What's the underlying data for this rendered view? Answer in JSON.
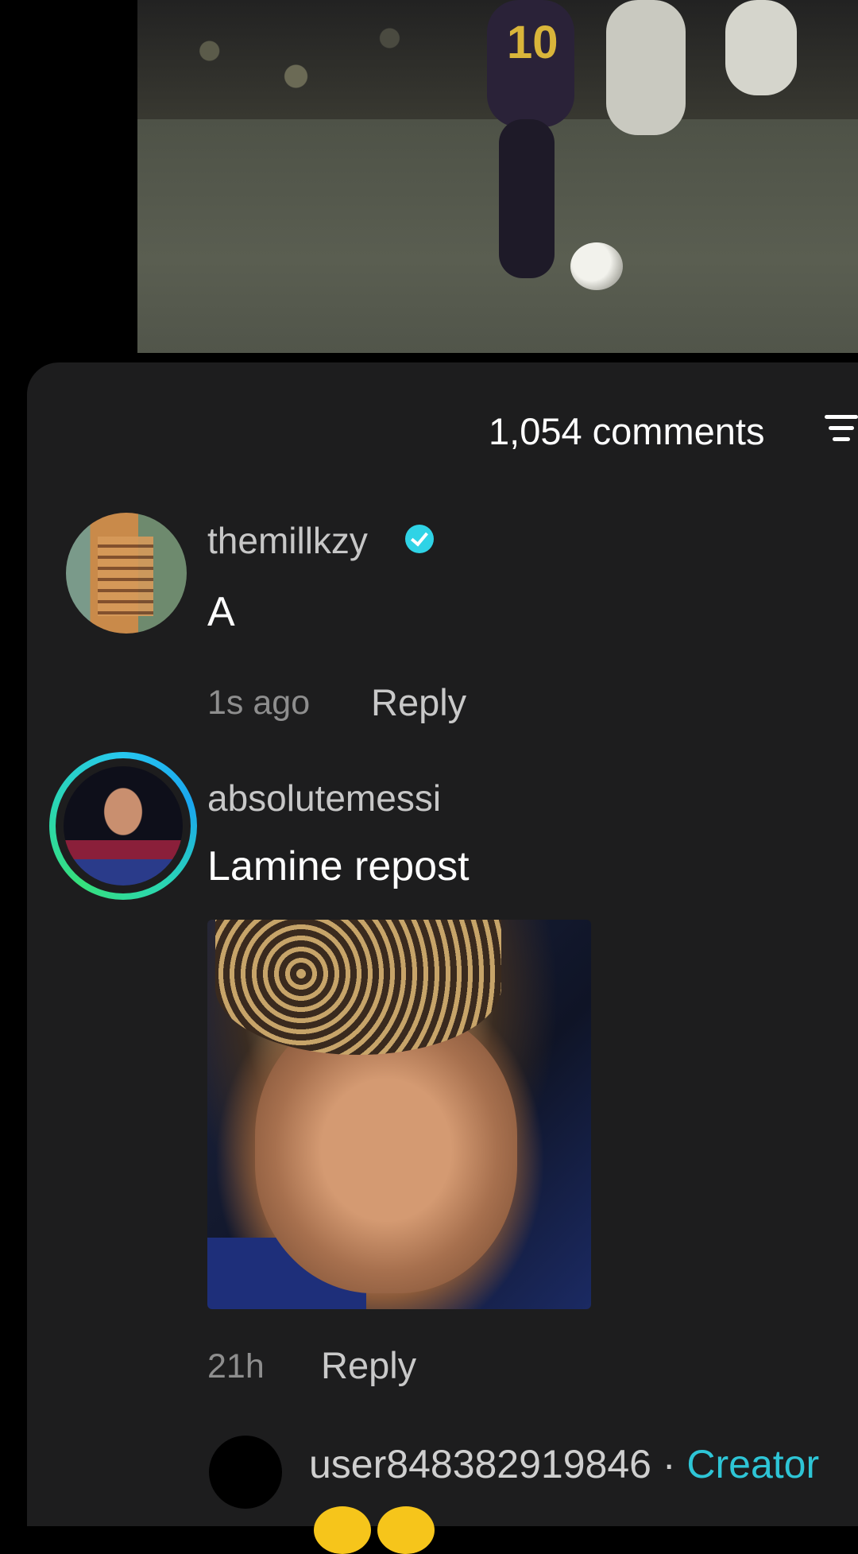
{
  "comments_header": {
    "count_label": "1,054 comments"
  },
  "comments": [
    {
      "username": "themillkzy",
      "verified": true,
      "text": "A",
      "time": "1s ago",
      "reply_label": "Reply"
    },
    {
      "username": "absolutemessi",
      "verified": false,
      "text": "Lamine repost",
      "time": "21h",
      "reply_label": "Reply"
    }
  ],
  "reply_preview": {
    "username": "user848382919846",
    "separator": " · ",
    "badge": "Creator"
  },
  "colors": {
    "sheet_bg": "#1d1d1e",
    "accent_cyan": "#2ec5d6",
    "ring_gradient_start": "#27c7f0",
    "ring_gradient_end": "#36e07c"
  }
}
